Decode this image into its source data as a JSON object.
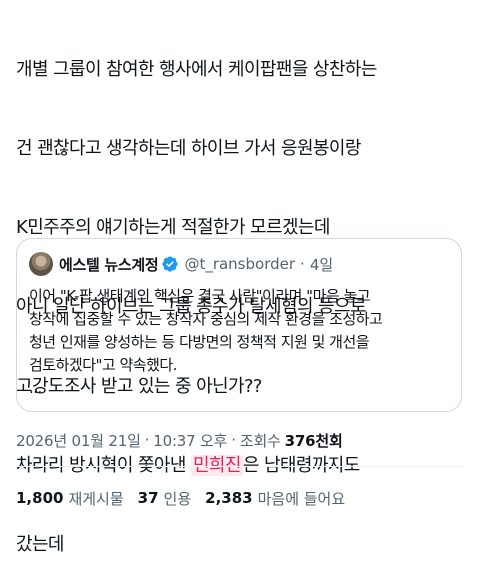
{
  "tweet": {
    "lines": [
      "개별 그룹이 참여한 행사에서 케이팝팬을 상찬하는",
      "건 괜찮다고 생각하는데 하이브 가서 응원봉이랑",
      "K민주주의 얘기하는게 적절한가 모르겠는데",
      "아니 일단 하이브는 그룹 총수가 탈세혐의 등으로",
      "고강도조사 받고 있는 중 아닌가??",
      "차라리 방시혁이 쫓아낸 ",
      "민희진",
      "은 남태령까지도",
      "갔는데"
    ]
  },
  "quote": {
    "display_name": "에스텔 뉴스계정",
    "handle": "@t_ransborder",
    "dot": "·",
    "age": "4일",
    "lines": [
      "이어 \"K-팝 생태계의 핵심은 결국 사람\"이라며 \"마음 놓고",
      "창작에 집중할 수 있는 창작자 중심의 제작 환경을 조성하고",
      "청년 인재를 양성하는 등 다방면의 정책적 지원 및 개선을",
      "검토하겠다\"고 약속했다.",
      "..."
    ]
  },
  "meta": {
    "date": "2026년 01월 21일",
    "sep1": "·",
    "time": "10:37 오후",
    "sep2": "·",
    "views_label": "조회수",
    "views_count": "376천회"
  },
  "stats": {
    "reposts_count": "1,800",
    "reposts_label": "재게시물",
    "quotes_count": "37",
    "quotes_label": "인용",
    "likes_count": "2,383",
    "likes_label": "마음에 들어요"
  },
  "colors": {
    "text": "#0f1419",
    "secondary": "#536471",
    "border": "#cfd9de",
    "verified": "#1d9bf0",
    "highlight_bg": "#fde9ec",
    "highlight_text": "#e0245e"
  }
}
